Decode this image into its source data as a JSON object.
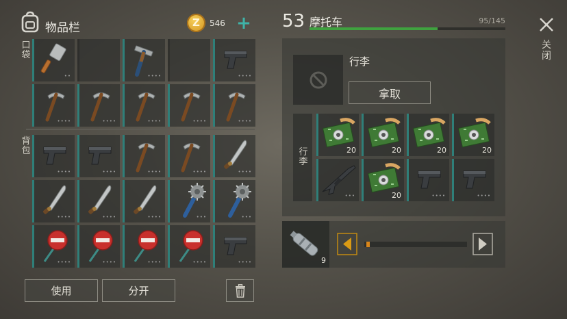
{
  "inventory": {
    "title": "物品栏",
    "coin_symbol": "Z",
    "coins": "546",
    "add_symbol": "+",
    "pocket_label": "口袋",
    "backpack_label": "背包",
    "use_label": "使用",
    "split_label": "分开",
    "pocket_slots": [
      "cleaver-icon",
      "empty",
      "hammer-icon",
      "empty",
      "pistol-icon",
      "pickaxe-icon",
      "pickaxe-icon",
      "pickaxe-icon",
      "pickaxe-icon",
      "pickaxe-icon"
    ],
    "backpack_slots": [
      "pistol-icon",
      "pistol-icon",
      "pickaxe-icon",
      "pickaxe-icon",
      "machete-icon",
      "machete-icon",
      "machete-icon",
      "machete-icon",
      "spiked-club-icon",
      "spiked-club-icon",
      "stop-sign-icon",
      "stop-sign-icon",
      "stop-sign-icon",
      "stop-sign-icon",
      "pistol-icon"
    ]
  },
  "vehicle": {
    "level": "53",
    "name": "摩托车",
    "capacity": "95/145",
    "capacity_fraction": 0.655,
    "luggage_title": "行李",
    "take_label": "拿取",
    "cargo_label": "行李",
    "cargo_slots": [
      {
        "icon": "circuit-board-icon",
        "qty": "20"
      },
      {
        "icon": "circuit-board-icon",
        "qty": "20"
      },
      {
        "icon": "circuit-board-icon",
        "qty": "20"
      },
      {
        "icon": "circuit-board-icon",
        "qty": "20"
      },
      {
        "icon": "rifle-icon",
        "qty": ""
      },
      {
        "icon": "circuit-board-icon",
        "qty": "20"
      },
      {
        "icon": "pistol-icon",
        "qty": ""
      },
      {
        "icon": "pistol-icon",
        "qty": ""
      }
    ]
  },
  "fuel": {
    "icon": "water-bottle-icon",
    "qty": "9",
    "slider_fraction": 0.02
  },
  "close_label": "关闭",
  "colors": {
    "accent": "#2f7f79",
    "capacity_bar": "#3fa23f",
    "coin": "#e0a52a"
  }
}
